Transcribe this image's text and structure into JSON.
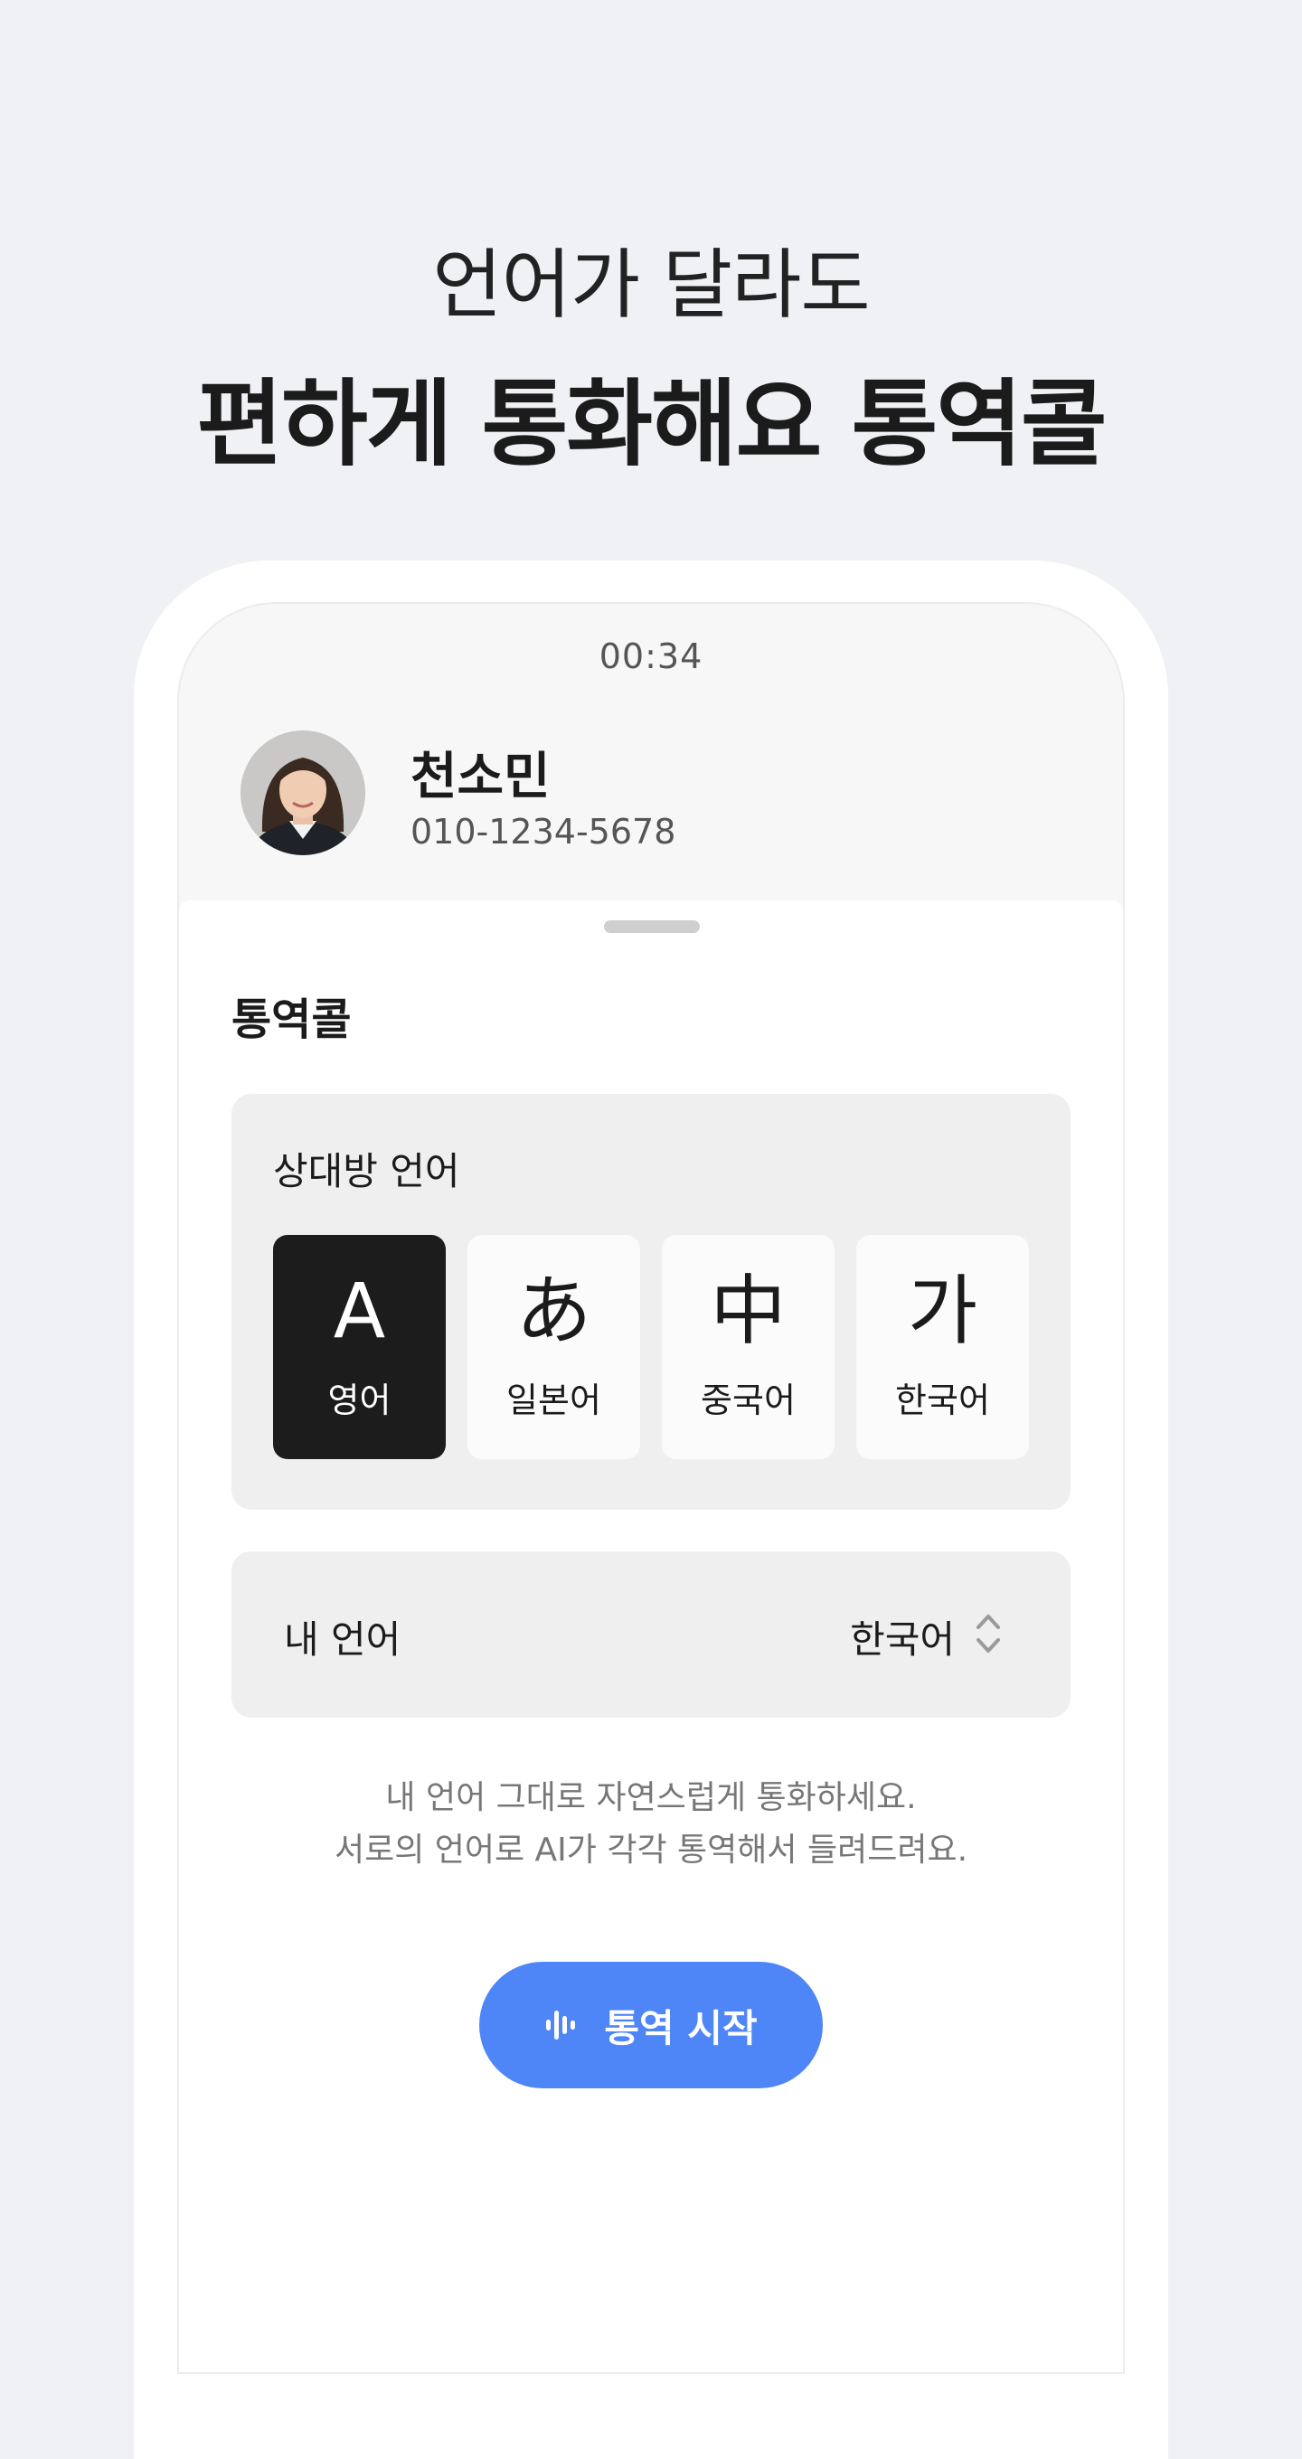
{
  "hero": {
    "line1": "언어가 달라도",
    "line2": "편하게 통화해요 통역콜"
  },
  "call": {
    "timer": "00:34",
    "caller_name": "천소민",
    "caller_phone": "010-1234-5678"
  },
  "sheet": {
    "title": "통역콜",
    "partner_language_label": "상대방 언어",
    "languages": [
      {
        "glyph": "A",
        "name": "영어",
        "selected": true
      },
      {
        "glyph": "あ",
        "name": "일본어",
        "selected": false
      },
      {
        "glyph": "中",
        "name": "중국어",
        "selected": false
      },
      {
        "glyph": "가",
        "name": "한국어",
        "selected": false
      }
    ],
    "my_language_label": "내 언어",
    "my_language_value": "한국어",
    "helper_line1": "내 언어 그대로 자연스럽게 통화하세요.",
    "helper_line2": "서로의 언어로 AI가 각각 통역해서 들려드려요.",
    "start_button": "통역 시작"
  },
  "colors": {
    "background": "#eff1f5",
    "accent": "#4f86f7",
    "selected_tile": "#1c1c1c"
  },
  "icons": {
    "avatar": "avatar-photo",
    "sort": "chevron-up-down-icon",
    "start": "waveform-icon"
  }
}
